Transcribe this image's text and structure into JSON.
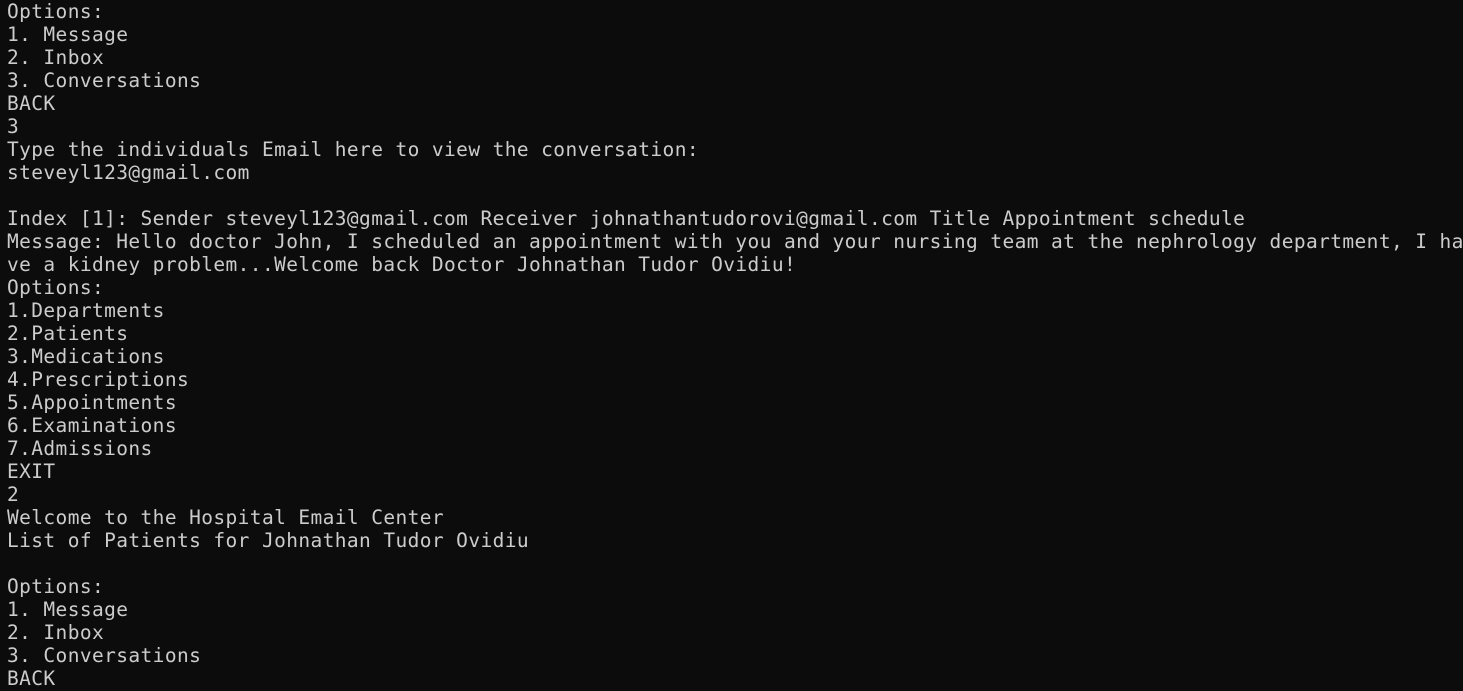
{
  "colors": {
    "background": "#0c0c0c",
    "foreground": "#cccccc"
  },
  "terminal": {
    "lines": [
      "Options:",
      "1. Message",
      "2. Inbox",
      "3. Conversations",
      "BACK",
      "3",
      "Type the individuals Email here to view the conversation:",
      "steveyl123@gmail.com",
      "",
      "Index [1]: Sender steveyl123@gmail.com Receiver johnathantudorovi@gmail.com Title Appointment schedule",
      "Message: Hello doctor John, I scheduled an appointment with you and your nursing team at the nephrology department, I ha",
      "ve a kidney problem...Welcome back Doctor Johnathan Tudor Ovidiu!",
      "Options:",
      "1.Departments",
      "2.Patients",
      "3.Medications",
      "4.Prescriptions",
      "5.Appointments",
      "6.Examinations",
      "7.Admissions",
      "EXIT",
      "2",
      "Welcome to the Hospital Email Center",
      "List of Patients for Johnathan Tudor Ovidiu",
      "",
      "Options:",
      "1. Message",
      "2. Inbox",
      "3. Conversations",
      "BACK"
    ]
  }
}
